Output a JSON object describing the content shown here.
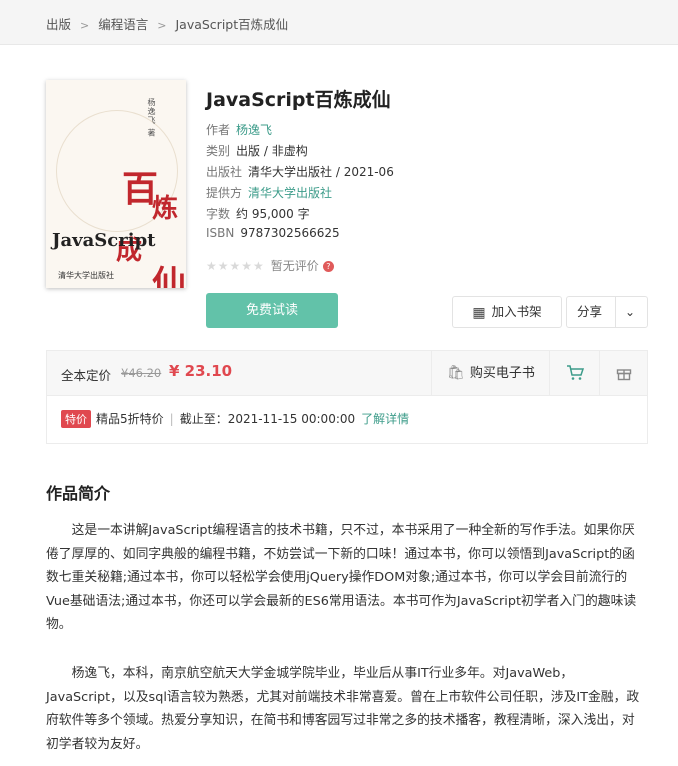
{
  "breadcrumb": [
    "出版",
    "编程语言",
    "JavaScript百炼成仙"
  ],
  "cover": {
    "author_vertical": "杨逸飞 著",
    "title_cn": [
      "百",
      "炼",
      "成",
      "仙"
    ],
    "title_en": "JavaScript",
    "publisher": "清华大学出版社"
  },
  "book": {
    "title": "JavaScript百炼成仙",
    "author_label": "作者",
    "author": "杨逸飞",
    "category_label": "类别",
    "category": "出版 / 非虚构",
    "publisher_label": "出版社",
    "publisher": "清华大学出版社 / 2021-06",
    "provider_label": "提供方",
    "provider": "清华大学出版社",
    "wordcount_label": "字数",
    "wordcount": "约 95,000 字",
    "isbn_label": "ISBN",
    "isbn": "9787302566625",
    "stars": "★★★★★",
    "rating_text": "暂无评价",
    "rating_help": "?"
  },
  "actions": {
    "trial": "免费试读",
    "add_shelf": "加入书架",
    "share": "分享"
  },
  "price": {
    "label": "全本定价",
    "old": "¥46.20",
    "new": "¥ 23.10",
    "buy": "购买电子书"
  },
  "promo": {
    "badge": "特价",
    "text": "精品5折特价",
    "deadline": "截止至：2021-11-15 00:00:00",
    "link": "了解详情"
  },
  "intro": {
    "title": "作品简介",
    "p1": "这是一本讲解JavaScript编程语言的技术书籍，只不过，本书采用了一种全新的写作手法。如果你厌倦了厚厚的、如同字典般的编程书籍，不妨尝试一下新的口味！通过本书，你可以领悟到JavaScript的函数七重关秘籍;通过本书，你可以轻松学会使用jQuery操作DOM对象;通过本书，你可以学会目前流行的Vue基础语法;通过本书，你还可以学会最新的ES6常用语法。本书可作为JavaScript初学者入门的趣味读物。",
    "p2": "杨逸飞，本科，南京航空航天大学金城学院毕业，毕业后从事IT行业多年。对JavaWeb，JavaScript，以及sql语言较为熟悉，尤其对前端技术非常喜爱。曾在上市软件公司任职，涉及IT金融，政府软件等多个领域。热爱分享知识，在简书和博客园写过非常之多的技术播客，教程清晰，深入浅出，对初学者较为友好。"
  }
}
